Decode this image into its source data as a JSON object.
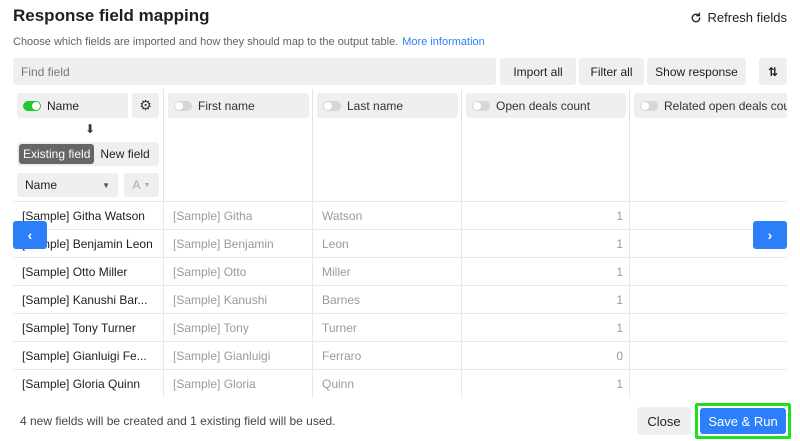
{
  "dialog": {
    "title": "Response field mapping",
    "refresh_label": "Refresh fields",
    "subtitle": "Choose which fields are imported and how they should map to the output table.",
    "more_info": "More information"
  },
  "toolbar": {
    "search_placeholder": "Find field",
    "import_all": "Import all",
    "filter_all": "Filter all",
    "show_response": "Show response",
    "sort_icon": "sort-arrows-icon"
  },
  "columns": [
    {
      "label": "Name",
      "enabled": true
    },
    {
      "label": "First name",
      "enabled": false
    },
    {
      "label": "Last name",
      "enabled": false
    },
    {
      "label": "Open deals count",
      "enabled": false
    },
    {
      "label": "Related open deals cour",
      "enabled": false
    }
  ],
  "mapping": {
    "existing_field": "Existing field",
    "new_field": "New field",
    "selected_field": "Name",
    "type_glyph": "A"
  },
  "rows": [
    {
      "name": "[Sample] Githa Watson",
      "first": "[Sample] Githa",
      "last": "Watson",
      "count": "1"
    },
    {
      "name": "[Sample] Benjamin Leon",
      "first": "[Sample] Benjamin",
      "last": "Leon",
      "count": "1"
    },
    {
      "name": "[Sample] Otto Miller",
      "first": "[Sample] Otto",
      "last": "Miller",
      "count": "1"
    },
    {
      "name": "[Sample] Kanushi Bar...",
      "first": "[Sample] Kanushi",
      "last": "Barnes",
      "count": "1"
    },
    {
      "name": "[Sample] Tony Turner",
      "first": "[Sample] Tony",
      "last": "Turner",
      "count": "1"
    },
    {
      "name": "[Sample] Gianluigi Fe...",
      "first": "[Sample] Gianluigi",
      "last": "Ferraro",
      "count": "0"
    },
    {
      "name": "[Sample] Gloria Quinn",
      "first": "[Sample] Gloria",
      "last": "Quinn",
      "count": "1"
    }
  ],
  "footer": {
    "summary": "4 new fields will be created and 1 existing field will be used.",
    "close": "Close",
    "save_run": "Save & Run"
  },
  "colors": {
    "accent": "#2d7ff9",
    "toggle_on": "#20c933",
    "highlight": "#1ee01e"
  }
}
